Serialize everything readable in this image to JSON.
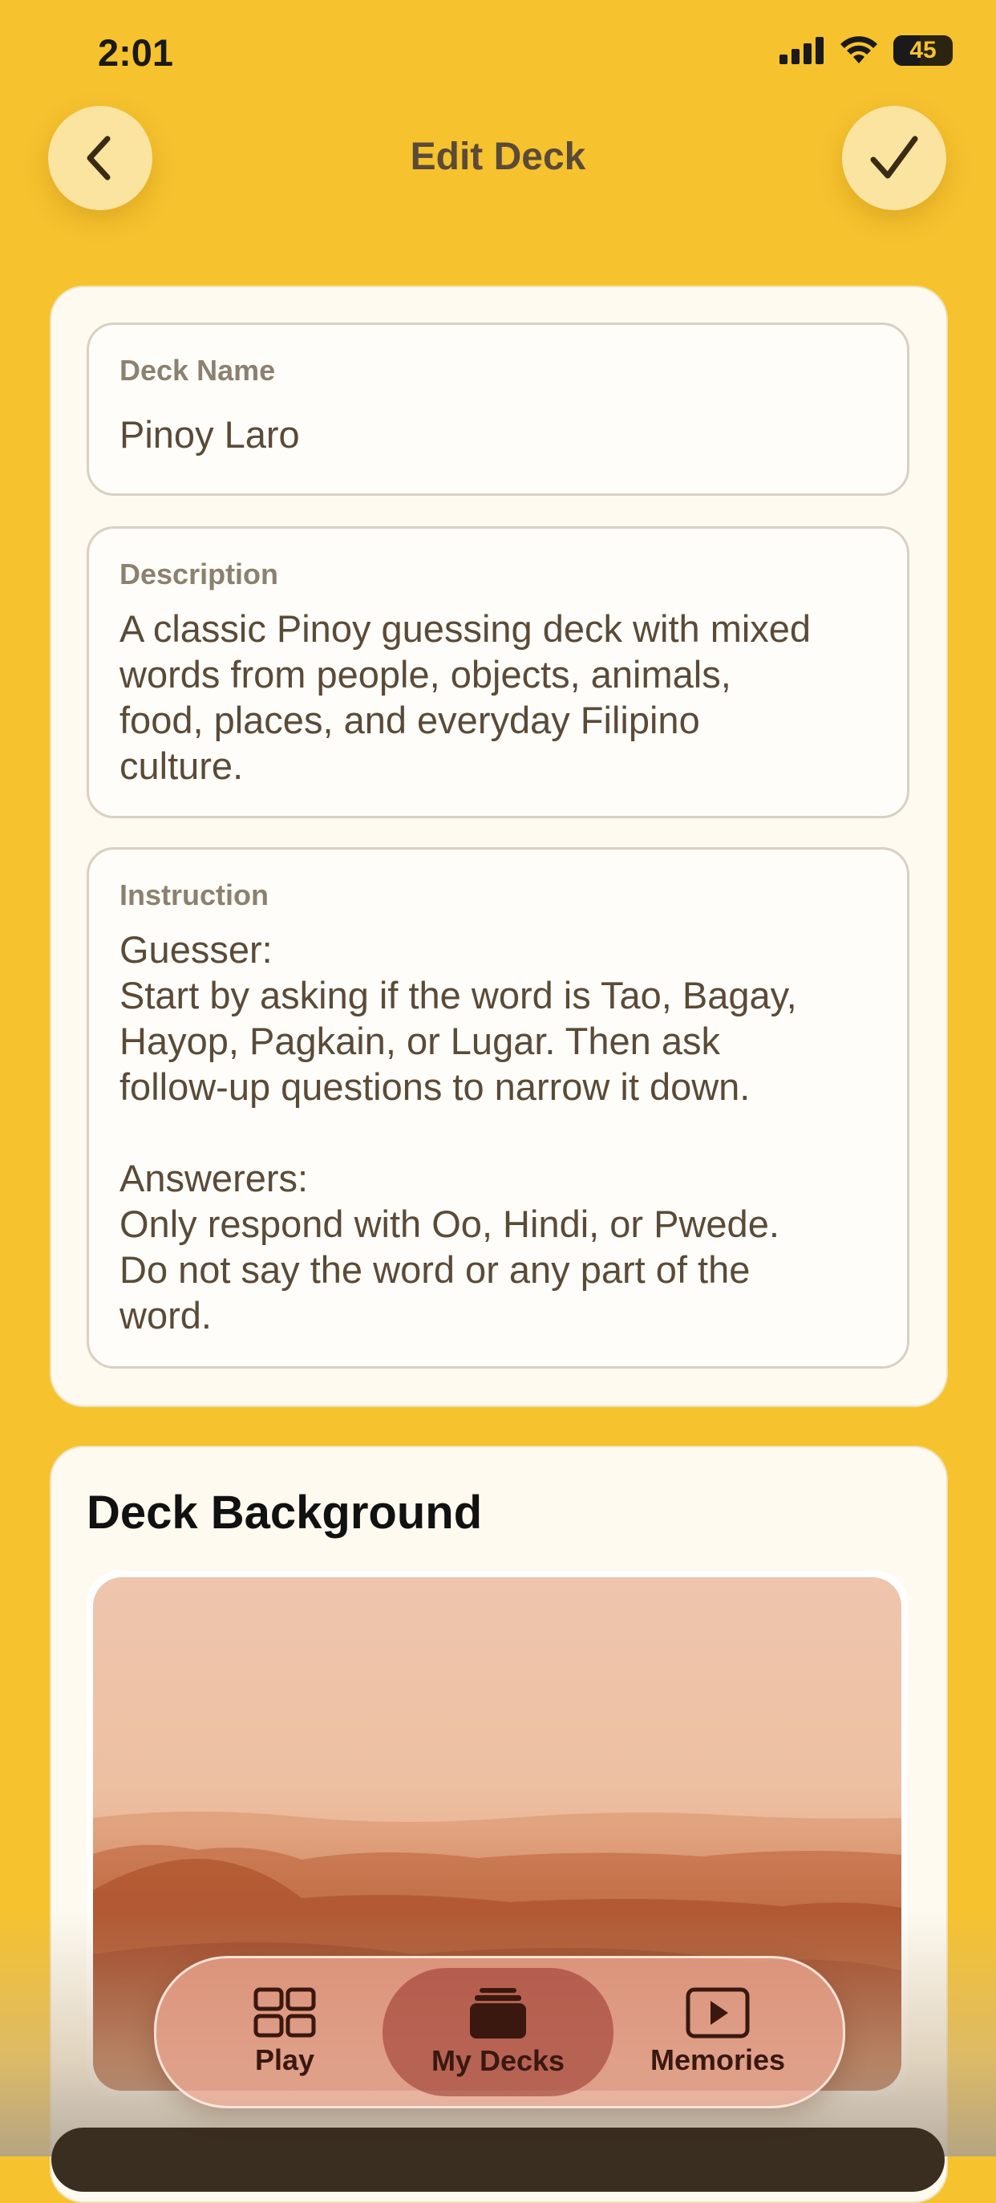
{
  "status": {
    "time": "2:01",
    "battery": "45"
  },
  "nav": {
    "title": "Edit Deck"
  },
  "form": {
    "deck_name": {
      "label": "Deck Name",
      "value": "Pinoy Laro"
    },
    "description": {
      "label": "Description",
      "value": "A classic Pinoy guessing deck with mixed\nwords from people, objects, animals,\nfood, places, and everyday Filipino\nculture."
    },
    "instruction": {
      "label": "Instruction",
      "value": "Guesser:\nStart by asking if the word is Tao, Bagay,\nHayop, Pagkain, or Lugar. Then ask\nfollow-up questions to narrow it down.\n\nAnswerers:\nOnly respond with Oo, Hindi, or Pwede.\nDo not say the word or any part of the\nword."
    }
  },
  "background_section": {
    "title": "Deck Background"
  },
  "tabbar": {
    "items": [
      {
        "label": "Play",
        "icon": "grid-icon"
      },
      {
        "label": "My Decks",
        "icon": "stack-icon",
        "active": true
      },
      {
        "label": "Memories",
        "icon": "play-icon"
      }
    ]
  }
}
